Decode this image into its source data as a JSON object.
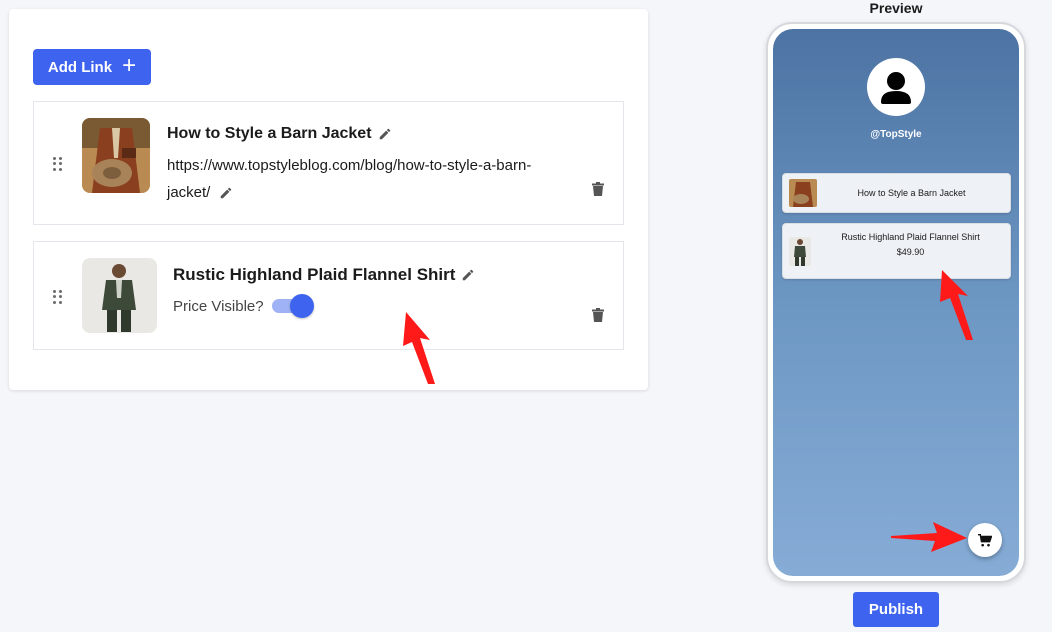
{
  "editor": {
    "add_link_label": "Add Link",
    "items": [
      {
        "title": "How to Style a Barn Jacket",
        "url": "https://www.topstyleblog.com/blog/how-to-style-a-barn-jacket/"
      },
      {
        "title": "Rustic Highland Plaid Flannel Shirt",
        "price_label": "Price Visible?",
        "price_visible": true
      }
    ]
  },
  "preview": {
    "label": "Preview",
    "username": "@TopStyle",
    "links": [
      {
        "title": "How to Style a Barn Jacket"
      },
      {
        "title": "Rustic Highland Plaid Flannel Shirt",
        "price": "$49.90"
      }
    ],
    "publish_label": "Publish"
  },
  "colors": {
    "accent": "#3d63ef",
    "annotation": "#ff1a1a",
    "phone_gradient_top": "#4c73a3",
    "phone_gradient_bottom": "#86acd6"
  },
  "icons": [
    "plus-icon",
    "drag-handle-icon",
    "pencil-icon",
    "trash-icon",
    "user-avatar-icon",
    "cart-icon"
  ]
}
